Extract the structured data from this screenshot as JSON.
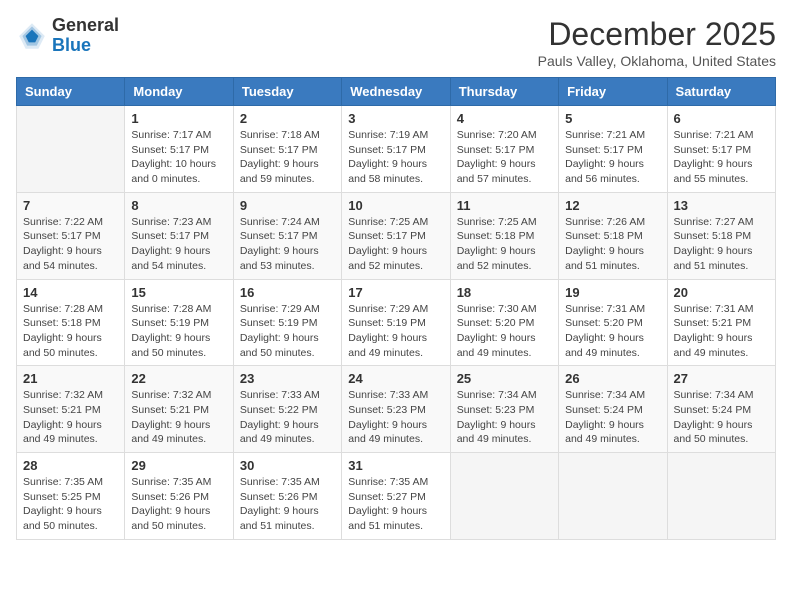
{
  "header": {
    "logo_general": "General",
    "logo_blue": "Blue",
    "month_title": "December 2025",
    "subtitle": "Pauls Valley, Oklahoma, United States"
  },
  "weekdays": [
    "Sunday",
    "Monday",
    "Tuesday",
    "Wednesday",
    "Thursday",
    "Friday",
    "Saturday"
  ],
  "weeks": [
    [
      {
        "day": "",
        "info": ""
      },
      {
        "day": "1",
        "info": "Sunrise: 7:17 AM\nSunset: 5:17 PM\nDaylight: 10 hours\nand 0 minutes."
      },
      {
        "day": "2",
        "info": "Sunrise: 7:18 AM\nSunset: 5:17 PM\nDaylight: 9 hours\nand 59 minutes."
      },
      {
        "day": "3",
        "info": "Sunrise: 7:19 AM\nSunset: 5:17 PM\nDaylight: 9 hours\nand 58 minutes."
      },
      {
        "day": "4",
        "info": "Sunrise: 7:20 AM\nSunset: 5:17 PM\nDaylight: 9 hours\nand 57 minutes."
      },
      {
        "day": "5",
        "info": "Sunrise: 7:21 AM\nSunset: 5:17 PM\nDaylight: 9 hours\nand 56 minutes."
      },
      {
        "day": "6",
        "info": "Sunrise: 7:21 AM\nSunset: 5:17 PM\nDaylight: 9 hours\nand 55 minutes."
      }
    ],
    [
      {
        "day": "7",
        "info": "Sunrise: 7:22 AM\nSunset: 5:17 PM\nDaylight: 9 hours\nand 54 minutes."
      },
      {
        "day": "8",
        "info": "Sunrise: 7:23 AM\nSunset: 5:17 PM\nDaylight: 9 hours\nand 54 minutes."
      },
      {
        "day": "9",
        "info": "Sunrise: 7:24 AM\nSunset: 5:17 PM\nDaylight: 9 hours\nand 53 minutes."
      },
      {
        "day": "10",
        "info": "Sunrise: 7:25 AM\nSunset: 5:17 PM\nDaylight: 9 hours\nand 52 minutes."
      },
      {
        "day": "11",
        "info": "Sunrise: 7:25 AM\nSunset: 5:18 PM\nDaylight: 9 hours\nand 52 minutes."
      },
      {
        "day": "12",
        "info": "Sunrise: 7:26 AM\nSunset: 5:18 PM\nDaylight: 9 hours\nand 51 minutes."
      },
      {
        "day": "13",
        "info": "Sunrise: 7:27 AM\nSunset: 5:18 PM\nDaylight: 9 hours\nand 51 minutes."
      }
    ],
    [
      {
        "day": "14",
        "info": "Sunrise: 7:28 AM\nSunset: 5:18 PM\nDaylight: 9 hours\nand 50 minutes."
      },
      {
        "day": "15",
        "info": "Sunrise: 7:28 AM\nSunset: 5:19 PM\nDaylight: 9 hours\nand 50 minutes."
      },
      {
        "day": "16",
        "info": "Sunrise: 7:29 AM\nSunset: 5:19 PM\nDaylight: 9 hours\nand 50 minutes."
      },
      {
        "day": "17",
        "info": "Sunrise: 7:29 AM\nSunset: 5:19 PM\nDaylight: 9 hours\nand 49 minutes."
      },
      {
        "day": "18",
        "info": "Sunrise: 7:30 AM\nSunset: 5:20 PM\nDaylight: 9 hours\nand 49 minutes."
      },
      {
        "day": "19",
        "info": "Sunrise: 7:31 AM\nSunset: 5:20 PM\nDaylight: 9 hours\nand 49 minutes."
      },
      {
        "day": "20",
        "info": "Sunrise: 7:31 AM\nSunset: 5:21 PM\nDaylight: 9 hours\nand 49 minutes."
      }
    ],
    [
      {
        "day": "21",
        "info": "Sunrise: 7:32 AM\nSunset: 5:21 PM\nDaylight: 9 hours\nand 49 minutes."
      },
      {
        "day": "22",
        "info": "Sunrise: 7:32 AM\nSunset: 5:21 PM\nDaylight: 9 hours\nand 49 minutes."
      },
      {
        "day": "23",
        "info": "Sunrise: 7:33 AM\nSunset: 5:22 PM\nDaylight: 9 hours\nand 49 minutes."
      },
      {
        "day": "24",
        "info": "Sunrise: 7:33 AM\nSunset: 5:23 PM\nDaylight: 9 hours\nand 49 minutes."
      },
      {
        "day": "25",
        "info": "Sunrise: 7:34 AM\nSunset: 5:23 PM\nDaylight: 9 hours\nand 49 minutes."
      },
      {
        "day": "26",
        "info": "Sunrise: 7:34 AM\nSunset: 5:24 PM\nDaylight: 9 hours\nand 49 minutes."
      },
      {
        "day": "27",
        "info": "Sunrise: 7:34 AM\nSunset: 5:24 PM\nDaylight: 9 hours\nand 50 minutes."
      }
    ],
    [
      {
        "day": "28",
        "info": "Sunrise: 7:35 AM\nSunset: 5:25 PM\nDaylight: 9 hours\nand 50 minutes."
      },
      {
        "day": "29",
        "info": "Sunrise: 7:35 AM\nSunset: 5:26 PM\nDaylight: 9 hours\nand 50 minutes."
      },
      {
        "day": "30",
        "info": "Sunrise: 7:35 AM\nSunset: 5:26 PM\nDaylight: 9 hours\nand 51 minutes."
      },
      {
        "day": "31",
        "info": "Sunrise: 7:35 AM\nSunset: 5:27 PM\nDaylight: 9 hours\nand 51 minutes."
      },
      {
        "day": "",
        "info": ""
      },
      {
        "day": "",
        "info": ""
      },
      {
        "day": "",
        "info": ""
      }
    ]
  ]
}
